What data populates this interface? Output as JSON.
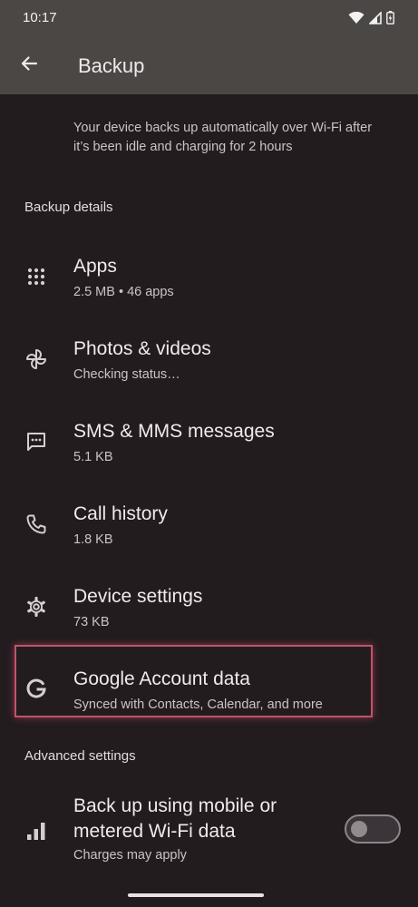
{
  "status_bar": {
    "time": "10:17",
    "icons": [
      "wifi-icon",
      "signal-icon",
      "battery-charging-icon"
    ]
  },
  "app_bar": {
    "back_icon": "arrow-back-icon",
    "title": "Backup"
  },
  "description": "Your device backs up automatically over Wi-Fi after it’s been idle and charging for 2 hours",
  "backup_details": {
    "header": "Backup details",
    "items": [
      {
        "icon": "apps-grid-icon",
        "title": "Apps",
        "subtitle": "2.5 MB • 46 apps"
      },
      {
        "icon": "pinwheel-icon",
        "title": "Photos & videos",
        "subtitle": "Checking status…"
      },
      {
        "icon": "message-icon",
        "title": "SMS & MMS messages",
        "subtitle": "5.1 KB"
      },
      {
        "icon": "phone-icon",
        "title": "Call history",
        "subtitle": "1.8 KB"
      },
      {
        "icon": "gear-icon",
        "title": "Device settings",
        "subtitle": "73 KB"
      },
      {
        "icon": "google-g-icon",
        "title": "Google Account data",
        "subtitle": "Synced with Contacts, Calendar, and more"
      }
    ]
  },
  "advanced_settings": {
    "header": "Advanced settings",
    "mobile_data": {
      "icon": "signal-bars-icon",
      "title": "Back up using mobile or metered Wi-Fi data",
      "subtitle": "Charges may apply",
      "toggle_on": false
    }
  },
  "colors": {
    "background": "#221c1f",
    "app_bar": "#4b4745",
    "highlight": "#c2536a"
  }
}
